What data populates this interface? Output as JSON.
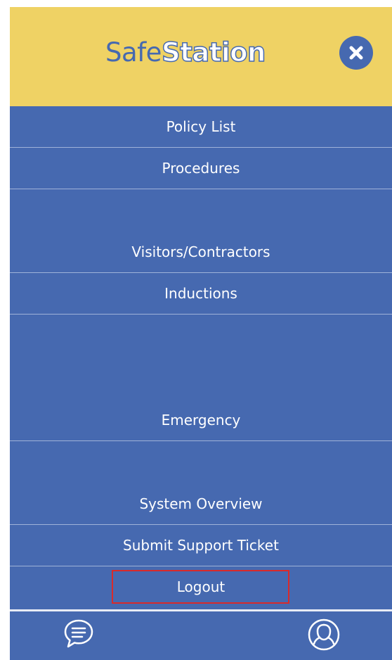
{
  "header": {
    "logo_part1": "Safe",
    "logo_part2": "Station",
    "close_icon": "close-x-icon"
  },
  "menu": {
    "items": [
      {
        "label": "Policy List"
      },
      {
        "label": "Procedures"
      },
      {
        "label": "Visitors/Contractors"
      },
      {
        "label": "Inductions"
      },
      {
        "label": "Emergency"
      },
      {
        "label": "System Overview"
      },
      {
        "label": "Submit Support Ticket"
      },
      {
        "label": "Logout"
      }
    ]
  },
  "bottom_nav": {
    "chat_icon": "chat-bubble-icon",
    "profile_icon": "user-profile-icon"
  },
  "colors": {
    "header_bg": "#efd264",
    "menu_bg": "#4669b0",
    "highlight": "#d92a2a"
  }
}
